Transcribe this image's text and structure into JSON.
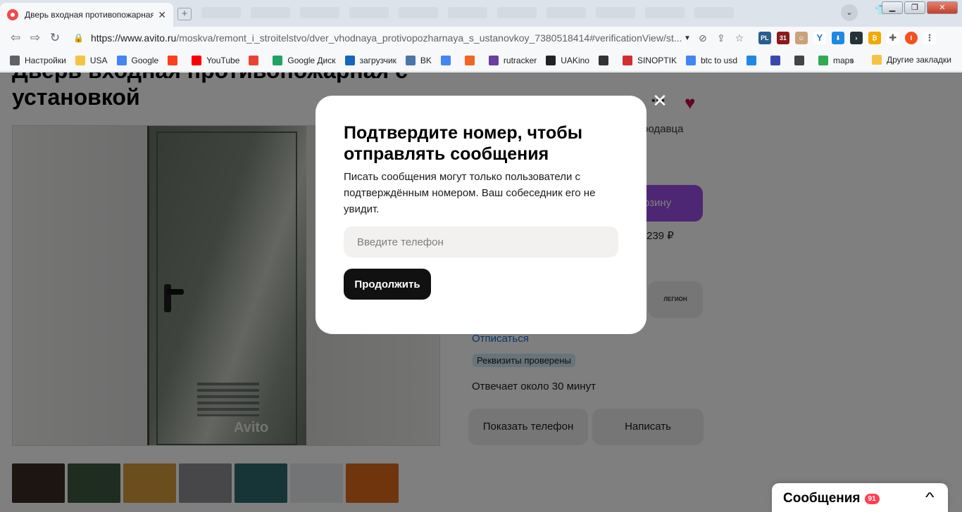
{
  "browser": {
    "tab_title": "Дверь входная противопожарная",
    "url_host": "https://www.avito.ru",
    "url_path": "/moskva/remont_i_stroitelstvo/dver_vhodnaya_protivopozharnaya_s_ustanovkoy_7380518414#verificationView/st...",
    "bookmarks": [
      {
        "label": "Настройки",
        "icon": "gear-icon",
        "color": "#5f6368"
      },
      {
        "label": "USA",
        "icon": "folder-icon",
        "color": "#f4c542"
      },
      {
        "label": "Google",
        "icon": "google-icon",
        "color": "#4285f4"
      },
      {
        "label": "",
        "icon": "yandex-icon",
        "color": "#fc3f1d"
      },
      {
        "label": "YouTube",
        "icon": "youtube-icon",
        "color": "#ff0000"
      },
      {
        "label": "",
        "icon": "gmail-icon",
        "color": "#ea4335"
      },
      {
        "label": "Google Диск",
        "icon": "drive-icon",
        "color": "#1fa463"
      },
      {
        "label": "загрузчик",
        "icon": "infinity-icon",
        "color": "#1565c0"
      },
      {
        "label": "BK",
        "icon": "vk-icon",
        "color": "#4a76a8"
      },
      {
        "label": "",
        "icon": "translate-icon",
        "color": "#4285f4"
      },
      {
        "label": "",
        "icon": "f-icon",
        "color": "#f26522"
      },
      {
        "label": "rutracker",
        "icon": "rutracker-icon",
        "color": "#6a3fa0"
      },
      {
        "label": "UAKino",
        "icon": "film-icon",
        "color": "#222222"
      },
      {
        "label": "",
        "icon": "chess-icon",
        "color": "#333333"
      },
      {
        "label": "SINOPTIK",
        "icon": "thermometer-icon",
        "color": "#d32f2f"
      },
      {
        "label": "btc to usd",
        "icon": "google-icon",
        "color": "#4285f4"
      },
      {
        "label": "",
        "icon": "p-icon",
        "color": "#1e88e5"
      },
      {
        "label": "",
        "icon": "arrow-icon",
        "color": "#3949ab"
      },
      {
        "label": "",
        "icon": "bc-icon",
        "color": "#444444"
      },
      {
        "label": "maps",
        "icon": "maps-icon",
        "color": "#34a853"
      }
    ],
    "bookmarks_more": "»",
    "other_bookmarks": "Другие закладки"
  },
  "listing": {
    "title": "Дверь входная противопожарная с установкой",
    "watermark": "Avito",
    "seller_suffix": "родавца",
    "cart_label": "рзину",
    "price_fragment": "239 ₽",
    "seller_logo": "ЛЕГИОН",
    "unsubscribe": "Отписаться",
    "verified_badge": "Реквизиты проверены",
    "response_time": "Отвечает около 30 минут",
    "show_phone": "Показать телефон",
    "write": "Написать",
    "thumb_colors": [
      "#3a2a22",
      "#3c5a3e",
      "#d99a3a",
      "#8e8e92",
      "#2e6b6e",
      "#e6e8ea",
      "#e06a1a"
    ]
  },
  "messages": {
    "label": "Сообщения",
    "count": "91"
  },
  "modal": {
    "title": "Подтвердите номер, чтобы отправлять сообщения",
    "description": "Писать сообщения могут только пользователи с подтверждённым номером. Ваш собеседник его не увидит.",
    "phone_placeholder": "Введите телефон",
    "phone_value": "",
    "continue_label": "Продолжить"
  },
  "colors": {
    "accent_purple": "#9a4ee8",
    "link_blue": "#0a6fd8",
    "favorite_red": "#c11042",
    "badge_red": "#ff4053"
  }
}
